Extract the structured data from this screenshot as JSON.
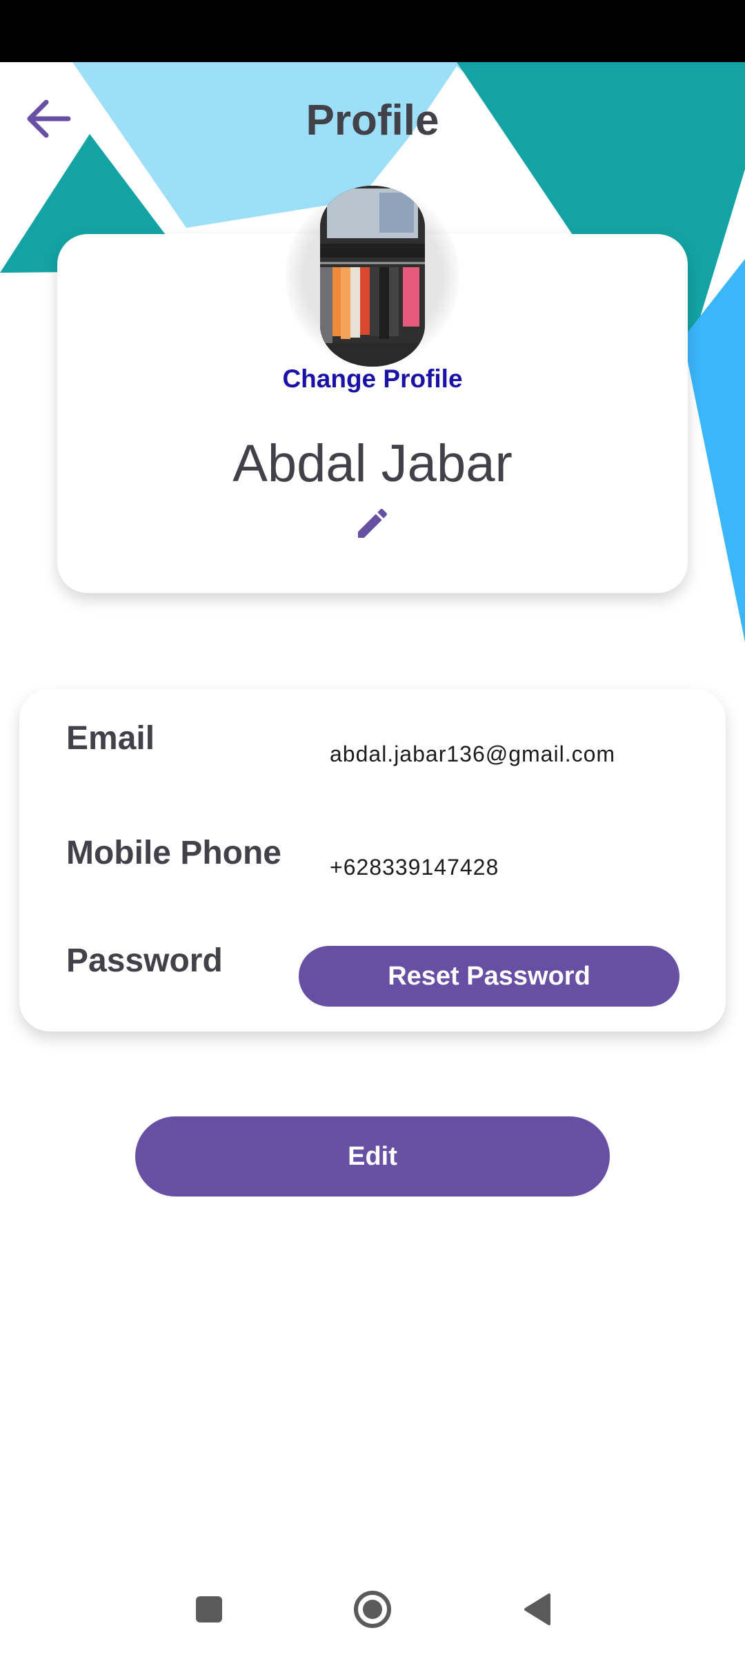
{
  "header": {
    "title": "Profile",
    "back_icon": "arrow-left-icon"
  },
  "profile": {
    "avatar_icon": "profile-photo",
    "change_profile_label": "Change Profile",
    "name": "Abdal Jabar",
    "edit_name_icon": "pencil-icon"
  },
  "details": {
    "email_label": "Email",
    "email_value": "abdal.jabar136@gmail.com",
    "phone_label": "Mobile Phone",
    "phone_value": "+628339147428",
    "password_label": "Password",
    "reset_password_label": "Reset Password"
  },
  "actions": {
    "edit_label": "Edit"
  },
  "nav": {
    "recents_icon": "square-icon",
    "home_icon": "circle-icon",
    "back_icon": "triangle-back-icon"
  },
  "colors": {
    "accent": "#6750a4",
    "link": "#1a12a8",
    "text_dark": "#424049",
    "bg_light_blue": "#9ddff7",
    "bg_teal": "#14a3a4",
    "bg_blue": "#3cb6fb"
  }
}
